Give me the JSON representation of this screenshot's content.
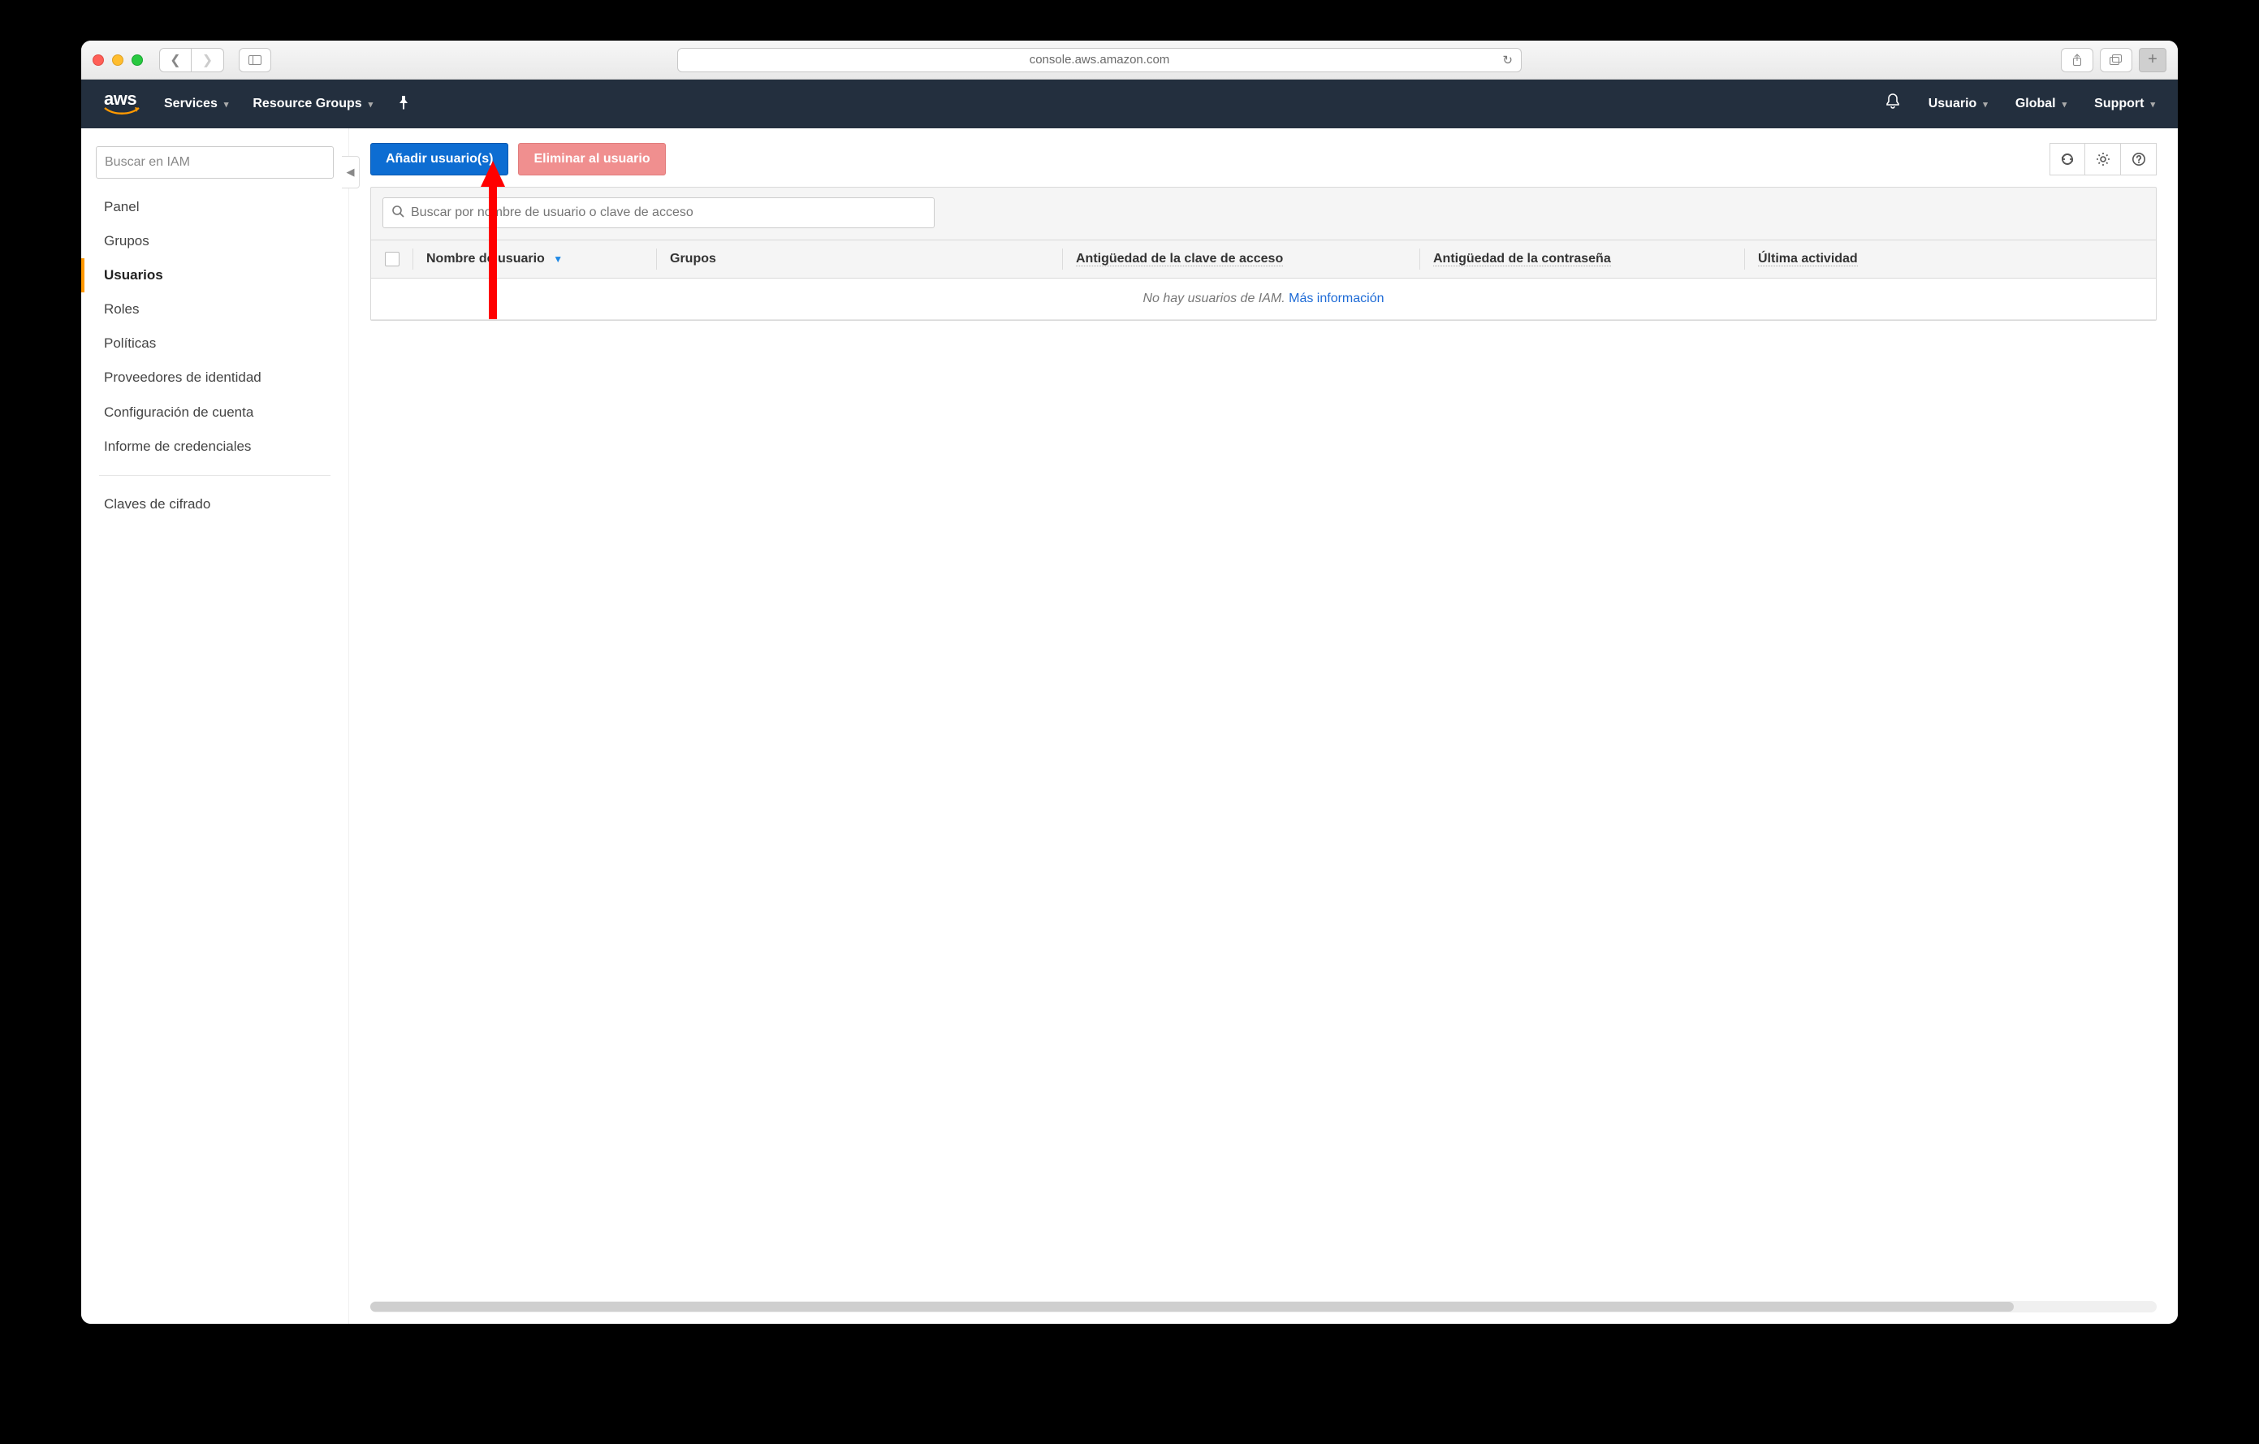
{
  "browser": {
    "url": "console.aws.amazon.com"
  },
  "header": {
    "services": "Services",
    "resource_groups": "Resource Groups",
    "user": "Usuario",
    "region": "Global",
    "support": "Support"
  },
  "sidebar": {
    "search_placeholder": "Buscar en IAM",
    "items": {
      "panel": "Panel",
      "grupos": "Grupos",
      "usuarios": "Usuarios",
      "roles": "Roles",
      "politicas": "Políticas",
      "proveedores": "Proveedores de identidad",
      "config_cuenta": "Configuración de cuenta",
      "informe_cred": "Informe de credenciales",
      "claves_cifrado": "Claves de cifrado"
    }
  },
  "toolbar": {
    "add_user": "Añadir usuario(s)",
    "delete_user": "Eliminar al usuario"
  },
  "table": {
    "search_placeholder": "Buscar por nombre de usuario o clave de acceso",
    "columns": {
      "username": "Nombre de usuario",
      "groups": "Grupos",
      "key_age": "Antigüedad de la clave de acceso",
      "pw_age": "Antigüedad de la contraseña",
      "last_activity": "Última actividad"
    },
    "empty_text": "No hay usuarios de IAM. ",
    "more_info": "Más información"
  }
}
